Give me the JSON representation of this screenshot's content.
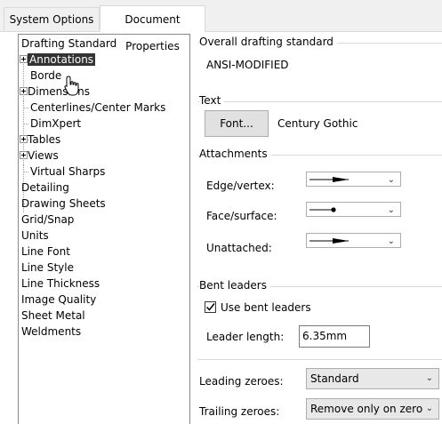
{
  "tabs": [
    {
      "label": "System Options"
    },
    {
      "label": "Document Properties"
    }
  ],
  "tree": {
    "items": [
      {
        "label": "Drafting Standard"
      },
      {
        "label": "Annotations"
      },
      {
        "label": "Borde"
      },
      {
        "label": "Dimensions"
      },
      {
        "label": "Centerlines/Center Marks"
      },
      {
        "label": "DimXpert"
      },
      {
        "label": "Tables"
      },
      {
        "label": "Views"
      },
      {
        "label": "Virtual Sharps"
      },
      {
        "label": "Detailing"
      },
      {
        "label": "Drawing Sheets"
      },
      {
        "label": "Grid/Snap"
      },
      {
        "label": "Units"
      },
      {
        "label": "Line Font"
      },
      {
        "label": "Line Style"
      },
      {
        "label": "Line Thickness"
      },
      {
        "label": "Image Quality"
      },
      {
        "label": "Sheet Metal"
      },
      {
        "label": "Weldments"
      }
    ]
  },
  "overall": {
    "title": "Overall drafting standard",
    "value": "ANSI-MODIFIED"
  },
  "text_group": {
    "title": "Text",
    "font_button": "Font...",
    "font_name": "Century Gothic"
  },
  "attachments": {
    "title": "Attachments",
    "edge_label": "Edge/vertex:",
    "face_label": "Face/surface:",
    "unattached_label": "Unattached:"
  },
  "bent": {
    "title": "Bent leaders",
    "use_label": "Use bent leaders",
    "use_checked": true,
    "length_label": "Leader length:",
    "length_value": "6.35mm"
  },
  "zeroes": {
    "leading_label": "Leading zeroes:",
    "leading_value": "Standard",
    "trailing_label": "Trailing zeroes:",
    "trailing_value": "Remove only on zero"
  },
  "colors": {
    "selected_bg": "#333333",
    "border": "#d9d9d9"
  }
}
